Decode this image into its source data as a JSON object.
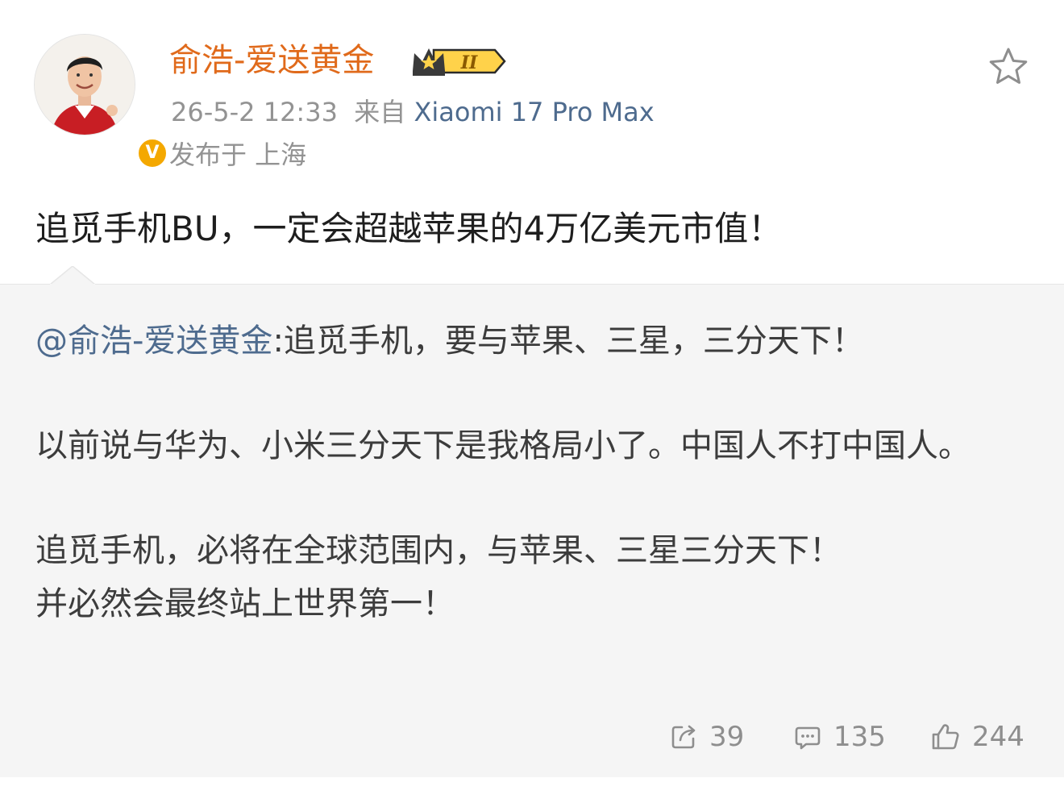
{
  "post": {
    "username": "俞浩-爱送黄金",
    "rank_badge": "II",
    "verified_mark": "V",
    "timestamp": "26-5-2 12:33",
    "source_prefix": "来自",
    "device": "Xiaomi 17 Pro Max",
    "location": "发布于 上海",
    "text": "追觅手机BU，一定会超越苹果的4万亿美元市值！"
  },
  "repost": {
    "mention": "@俞浩-爱送黄金",
    "line1": ":追觅手机，要与苹果、三星，三分天下！",
    "para2": "以前说与华为、小米三分天下是我格局小了。中国人不打中国人。",
    "para3_line1": "追觅手机，必将在全球范围内，与苹果、三星三分天下！",
    "para3_line2": "并必然会最终站上世界第一！"
  },
  "actions": {
    "repost_count": "39",
    "comment_count": "135",
    "like_count": "244"
  },
  "icons": [
    "star-icon",
    "repost-icon",
    "comment-icon",
    "like-icon",
    "verified-badge-icon",
    "crown-icon"
  ],
  "colors": {
    "username": "#e06a1b",
    "link": "#4e6b8e",
    "meta": "#939393",
    "verified": "#f4a800",
    "repost_bg": "#f5f5f5"
  }
}
